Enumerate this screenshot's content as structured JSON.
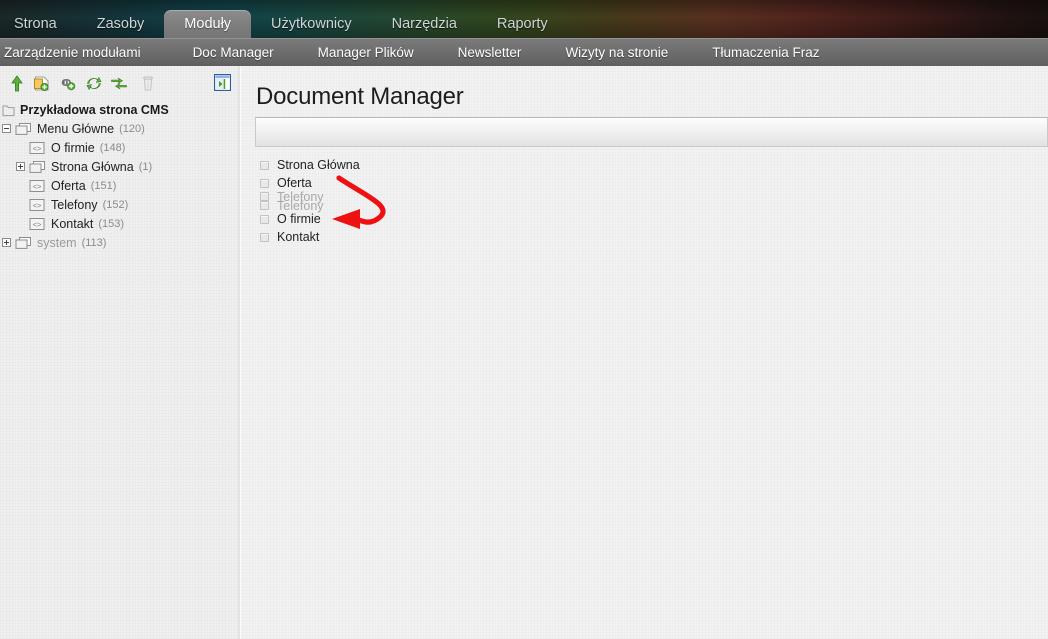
{
  "app": {
    "title": "Document Manager"
  },
  "header": {
    "tabs": [
      {
        "label": "Strona",
        "active": false
      },
      {
        "label": "Zasoby",
        "active": false
      },
      {
        "label": "Moduły",
        "active": true
      },
      {
        "label": "Użytkownicy",
        "active": false
      },
      {
        "label": "Narzędzia",
        "active": false
      },
      {
        "label": "Raporty",
        "active": false
      }
    ]
  },
  "subnav": {
    "items": [
      {
        "label": "Zarządzenie modułami"
      },
      {
        "label": "Doc Manager"
      },
      {
        "label": "Manager Plików"
      },
      {
        "label": "Newsletter"
      },
      {
        "label": "Wizyty na stronie"
      },
      {
        "label": "Tłumaczenia Fraz"
      }
    ]
  },
  "sidebar": {
    "toolbar": [
      {
        "name": "upload-icon",
        "title": "Upload"
      },
      {
        "name": "new-document-icon",
        "title": "New document"
      },
      {
        "name": "add-link-icon",
        "title": "Add link"
      },
      {
        "name": "refresh-icon",
        "title": "Refresh"
      },
      {
        "name": "move-icon",
        "title": "Move"
      },
      {
        "name": "delete-icon",
        "title": "Delete"
      },
      {
        "name": "collapse-panel-icon",
        "title": "Collapse panel"
      }
    ],
    "root": {
      "label": "Przykładowa strona CMS"
    },
    "tree": [
      {
        "label": "Menu Główne",
        "count": "(120)",
        "icon": "folder-icon",
        "twist": "minus",
        "depth": 0,
        "muted": false
      },
      {
        "label": "O firmie",
        "count": "(148)",
        "icon": "page-icon",
        "twist": "none",
        "depth": 1,
        "muted": false
      },
      {
        "label": "Strona Główna",
        "count": "(1)",
        "icon": "folder-icon",
        "twist": "plus",
        "depth": 1,
        "muted": false
      },
      {
        "label": "Oferta",
        "count": "(151)",
        "icon": "page-icon",
        "twist": "none",
        "depth": 1,
        "muted": false
      },
      {
        "label": "Telefony",
        "count": "(152)",
        "icon": "page-icon",
        "twist": "none",
        "depth": 1,
        "muted": false
      },
      {
        "label": "Kontakt",
        "count": "(153)",
        "icon": "page-icon",
        "twist": "none",
        "depth": 1,
        "muted": false
      },
      {
        "label": "system",
        "count": "(113)",
        "icon": "folder-icon",
        "twist": "plus",
        "depth": 0,
        "muted": true
      }
    ]
  },
  "main": {
    "title": "Document Manager",
    "documents": [
      {
        "label": "Strona Główna",
        "checked": false,
        "ghost": false
      },
      {
        "label": "Oferta",
        "checked": false,
        "ghost": false
      },
      {
        "label": "Telefony",
        "checked": false,
        "ghost": true
      },
      {
        "label": "Telefony",
        "checked": false,
        "ghost": true
      },
      {
        "label": "O firmie",
        "checked": false,
        "ghost": false
      },
      {
        "label": "Kontakt",
        "checked": false,
        "ghost": false
      }
    ]
  },
  "annotation": {
    "arrow_color": "#ee1111",
    "name": "red-curved-arrow"
  },
  "colors": {
    "subnav_bg": "#6e6e6e",
    "active_tab_bg": "#7d7d7d",
    "sidebar_bg": "#f0f0f0",
    "text_primary": "#222222",
    "text_muted": "#9a9a9a",
    "accent_green": "#4a9b2e",
    "annotation_red": "#ee1111"
  }
}
